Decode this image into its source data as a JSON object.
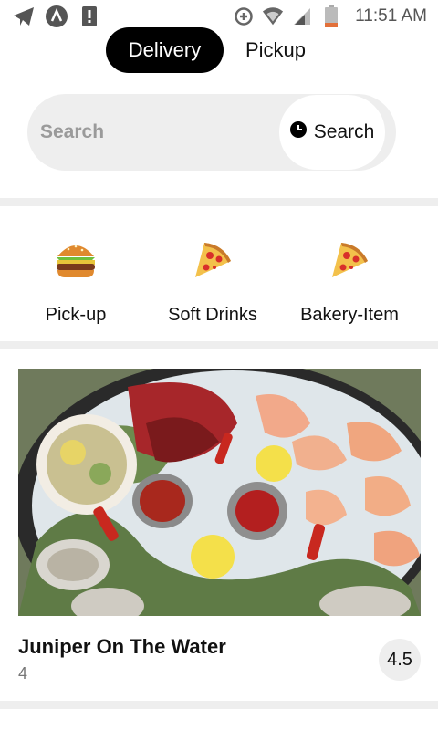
{
  "status_bar": {
    "time": "11:51 AM",
    "icons": [
      "telegram-icon",
      "app-a-icon",
      "alert-icon",
      "data-saver-icon",
      "wifi-icon",
      "signal-icon",
      "battery-icon"
    ]
  },
  "mode_toggle": {
    "delivery_label": "Delivery",
    "pickup_label": "Pickup",
    "active": "Delivery"
  },
  "search": {
    "placeholder": "Search",
    "button_label": "Search"
  },
  "categories": [
    {
      "label": "Pick-up",
      "icon": "burger-icon"
    },
    {
      "label": "Soft Drinks",
      "icon": "pizza-icon"
    },
    {
      "label": "Bakery-Item",
      "icon": "pizza-icon"
    }
  ],
  "restaurant": {
    "name": "Juniper On The Water",
    "subtitle": "4",
    "rating": "4.5"
  },
  "colors": {
    "accent": "#000000",
    "surface": "#eeeeee"
  }
}
